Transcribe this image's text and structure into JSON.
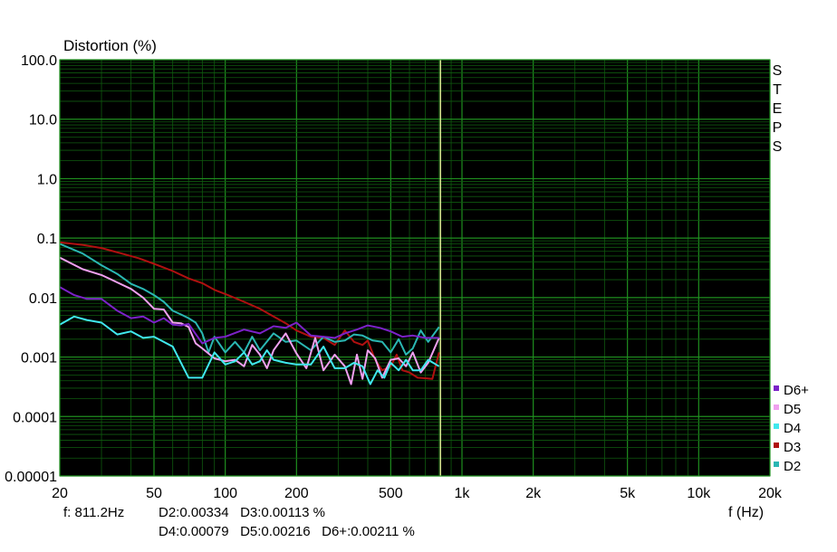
{
  "chart_data": {
    "type": "line",
    "title": "Distortion (%)",
    "xlabel": "f (Hz)",
    "side_label": "STEPS",
    "x_scale": "log",
    "y_scale": "log",
    "xlim": [
      20,
      20000
    ],
    "ylim": [
      1e-05,
      100
    ],
    "grid": true,
    "legend_position": "bottom-right",
    "x_ticks": [
      {
        "v": 20,
        "label": "20"
      },
      {
        "v": 50,
        "label": "50"
      },
      {
        "v": 100,
        "label": "100"
      },
      {
        "v": 200,
        "label": "200"
      },
      {
        "v": 500,
        "label": "500"
      },
      {
        "v": 1000,
        "label": "1k"
      },
      {
        "v": 2000,
        "label": "2k"
      },
      {
        "v": 5000,
        "label": "5k"
      },
      {
        "v": 10000,
        "label": "10k"
      },
      {
        "v": 20000,
        "label": "20k"
      }
    ],
    "y_ticks": [
      {
        "v": 100,
        "label": "100.0"
      },
      {
        "v": 10,
        "label": "10.0"
      },
      {
        "v": 1,
        "label": "1.0"
      },
      {
        "v": 0.1,
        "label": "0.1"
      },
      {
        "v": 0.01,
        "label": "0.01"
      },
      {
        "v": 0.001,
        "label": "0.001"
      },
      {
        "v": 0.0001,
        "label": "0.0001"
      },
      {
        "v": 1e-05,
        "label": "0.00001"
      }
    ],
    "cursor_x": 811.2,
    "series": [
      {
        "name": "D3",
        "color": "#b01010",
        "x": [
          20,
          25,
          30,
          36,
          43,
          50,
          60,
          70,
          80,
          90,
          100,
          120,
          140,
          160,
          180,
          200,
          230,
          260,
          290,
          320,
          350,
          380,
          400,
          430,
          460,
          500,
          530,
          560,
          600,
          650,
          700,
          750,
          800
        ],
        "y": [
          0.085,
          0.077,
          0.068,
          0.056,
          0.046,
          0.037,
          0.028,
          0.021,
          0.0175,
          0.0135,
          0.0115,
          0.0085,
          0.0065,
          0.0048,
          0.0037,
          0.0028,
          0.0022,
          0.0021,
          0.0016,
          0.0028,
          0.0018,
          0.0016,
          0.0019,
          0.0009,
          0.0006,
          0.0007,
          0.0011,
          0.0006,
          0.00055,
          0.00045,
          0.00044,
          0.00043,
          0.0012
        ]
      },
      {
        "name": "D2",
        "color": "#2ab7b3",
        "x": [
          20,
          25,
          30,
          35,
          40,
          45,
          50,
          55,
          60,
          65,
          70,
          75,
          80,
          85,
          90,
          100,
          110,
          120,
          130,
          140,
          160,
          180,
          200,
          230,
          260,
          290,
          320,
          350,
          380,
          420,
          460,
          500,
          540,
          580,
          620,
          670,
          720,
          800
        ],
        "y": [
          0.08,
          0.055,
          0.035,
          0.025,
          0.017,
          0.014,
          0.011,
          0.0085,
          0.006,
          0.0052,
          0.0045,
          0.0038,
          0.0025,
          0.0012,
          0.0022,
          0.0012,
          0.0018,
          0.0012,
          0.0022,
          0.0013,
          0.0025,
          0.0018,
          0.0019,
          0.0013,
          0.0022,
          0.0018,
          0.0019,
          0.0024,
          0.0023,
          0.0019,
          0.0018,
          0.0012,
          0.002,
          0.0011,
          0.0014,
          0.0028,
          0.0018,
          0.0032
        ]
      },
      {
        "name": "D5",
        "color": "#f0a0f0",
        "x": [
          20,
          25,
          30,
          35,
          40,
          45,
          50,
          55,
          60,
          65,
          70,
          75,
          80,
          90,
          100,
          110,
          120,
          130,
          140,
          150,
          160,
          180,
          200,
          220,
          240,
          260,
          290,
          320,
          340,
          360,
          380,
          400,
          430,
          460,
          500,
          540,
          580,
          620,
          670,
          720,
          800
        ],
        "y": [
          0.047,
          0.03,
          0.024,
          0.018,
          0.014,
          0.01,
          0.0065,
          0.0063,
          0.0038,
          0.0037,
          0.0032,
          0.0017,
          0.0014,
          0.00095,
          0.00085,
          0.0009,
          0.0007,
          0.0016,
          0.0011,
          0.00065,
          0.0013,
          0.0025,
          0.00115,
          0.00065,
          0.0021,
          0.0006,
          0.0011,
          0.0007,
          0.00035,
          0.0011,
          0.00043,
          0.0013,
          0.00095,
          0.00045,
          0.0009,
          0.00095,
          0.0007,
          0.0012,
          0.00055,
          0.0008,
          0.0021
        ]
      },
      {
        "name": "D6+",
        "color": "#7b22c8",
        "x": [
          20,
          23,
          26,
          30,
          35,
          40,
          45,
          50,
          55,
          60,
          65,
          70,
          80,
          90,
          100,
          120,
          140,
          160,
          180,
          200,
          230,
          260,
          290,
          320,
          360,
          400,
          450,
          500,
          560,
          620,
          700,
          800
        ],
        "y": [
          0.015,
          0.011,
          0.0095,
          0.0095,
          0.006,
          0.0045,
          0.0048,
          0.0038,
          0.0045,
          0.0035,
          0.0034,
          0.0036,
          0.0017,
          0.0021,
          0.0022,
          0.0029,
          0.0025,
          0.0033,
          0.0031,
          0.0038,
          0.0023,
          0.0022,
          0.0021,
          0.0025,
          0.0029,
          0.0034,
          0.0031,
          0.0027,
          0.0022,
          0.0023,
          0.0021,
          0.0021
        ]
      },
      {
        "name": "D4",
        "color": "#40e8ee",
        "x": [
          20,
          23,
          26,
          30,
          35,
          40,
          45,
          50,
          60,
          70,
          80,
          90,
          100,
          110,
          120,
          130,
          140,
          150,
          160,
          180,
          200,
          230,
          260,
          290,
          320,
          350,
          380,
          410,
          440,
          470,
          500,
          540,
          580,
          620,
          670,
          720,
          800
        ],
        "y": [
          0.0035,
          0.0048,
          0.0042,
          0.0038,
          0.0024,
          0.0027,
          0.0021,
          0.0022,
          0.0015,
          0.00045,
          0.00045,
          0.0012,
          0.00075,
          0.00085,
          0.0012,
          0.00075,
          0.00085,
          0.0013,
          0.0009,
          0.0008,
          0.00075,
          0.00075,
          0.0015,
          0.00065,
          0.00065,
          0.0008,
          0.0007,
          0.00035,
          0.0006,
          0.00045,
          0.0008,
          0.0006,
          0.0009,
          0.0006,
          0.0006,
          0.0009,
          0.0007
        ]
      }
    ],
    "legend": [
      {
        "label": "D6+",
        "color": "#7b22c8"
      },
      {
        "label": "D5",
        "color": "#f0a0f0"
      },
      {
        "label": "D4",
        "color": "#40e8ee"
      },
      {
        "label": "D3",
        "color": "#b01010"
      },
      {
        "label": "D2",
        "color": "#2ab7b3"
      }
    ]
  },
  "readout": {
    "freq": "f: 811.2Hz",
    "line1": "D2:0.00334   D3:0.00113 %",
    "line2": "D4:0.00079   D5:0.00216   D6+:0.00211 %"
  },
  "colors": {
    "plot_bg": "#000000",
    "grid_major": "#1f8f1f",
    "grid_minor": "#0f5a0f",
    "cursor": "#d8e890"
  }
}
